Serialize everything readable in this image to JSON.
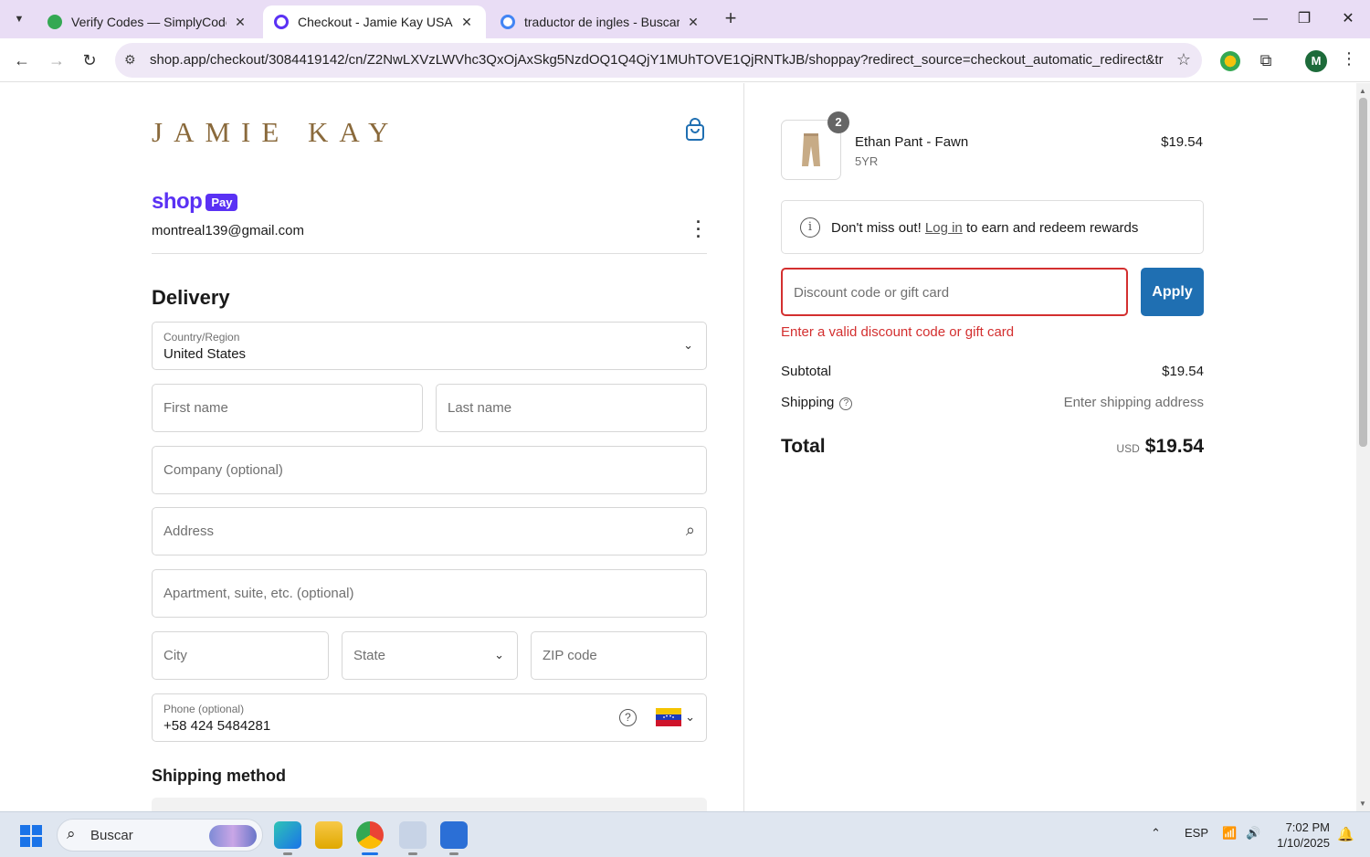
{
  "browser": {
    "tabs": [
      {
        "title": "Verify Codes — SimplyCodes",
        "favicon_color": "#34a853"
      },
      {
        "title": "Checkout - Jamie Kay USA",
        "favicon_color": "#5a31f4"
      },
      {
        "title": "traductor de ingles - Buscar con",
        "favicon_color": "#4285f4"
      }
    ],
    "url": "shop.app/checkout/3084419142/cn/Z2NwLXVzLWVhc3QxOjAxSkg5NzdOQ1Q4QjY1MUhTOVE1QjRNTkJB/shoppay?redirect_source=checkout_automatic_redirect&tracking...",
    "profile_initial": "M"
  },
  "checkout": {
    "brand": "JAMIE KAY",
    "shoppay_shop": "shop",
    "shoppay_pay": "Pay",
    "email": "montreal139@gmail.com",
    "delivery_heading": "Delivery",
    "country_label": "Country/Region",
    "country_value": "United States",
    "first_name_placeholder": "First name",
    "last_name_placeholder": "Last name",
    "company_placeholder": "Company (optional)",
    "address_placeholder": "Address",
    "apartment_placeholder": "Apartment, suite, etc. (optional)",
    "city_placeholder": "City",
    "state_placeholder": "State",
    "zip_placeholder": "ZIP code",
    "phone_label": "Phone (optional)",
    "phone_value": "+58 424 5484281",
    "shipping_method_heading": "Shipping method"
  },
  "summary": {
    "item": {
      "name": "Ethan Pant - Fawn",
      "variant": "5YR",
      "price": "$19.54",
      "quantity": "2"
    },
    "notice_before": "Don't miss out!",
    "notice_link": "Log in",
    "notice_after": "to earn and redeem rewards",
    "discount_placeholder": "Discount code or gift card",
    "apply_label": "Apply",
    "discount_error": "Enter a valid discount code or gift card",
    "subtotal_label": "Subtotal",
    "subtotal_value": "$19.54",
    "shipping_label": "Shipping",
    "shipping_value": "Enter shipping address",
    "total_label": "Total",
    "total_currency": "USD",
    "total_value": "$19.54"
  },
  "taskbar": {
    "search_label": "Buscar",
    "language": "ESP",
    "time": "7:02 PM",
    "date": "1/10/2025"
  },
  "colors": {
    "shoppay_purple": "#5a31f4",
    "error_red": "#d32f2f",
    "apply_blue": "#1f6fb2",
    "brand_gold": "#8a6a3c"
  }
}
